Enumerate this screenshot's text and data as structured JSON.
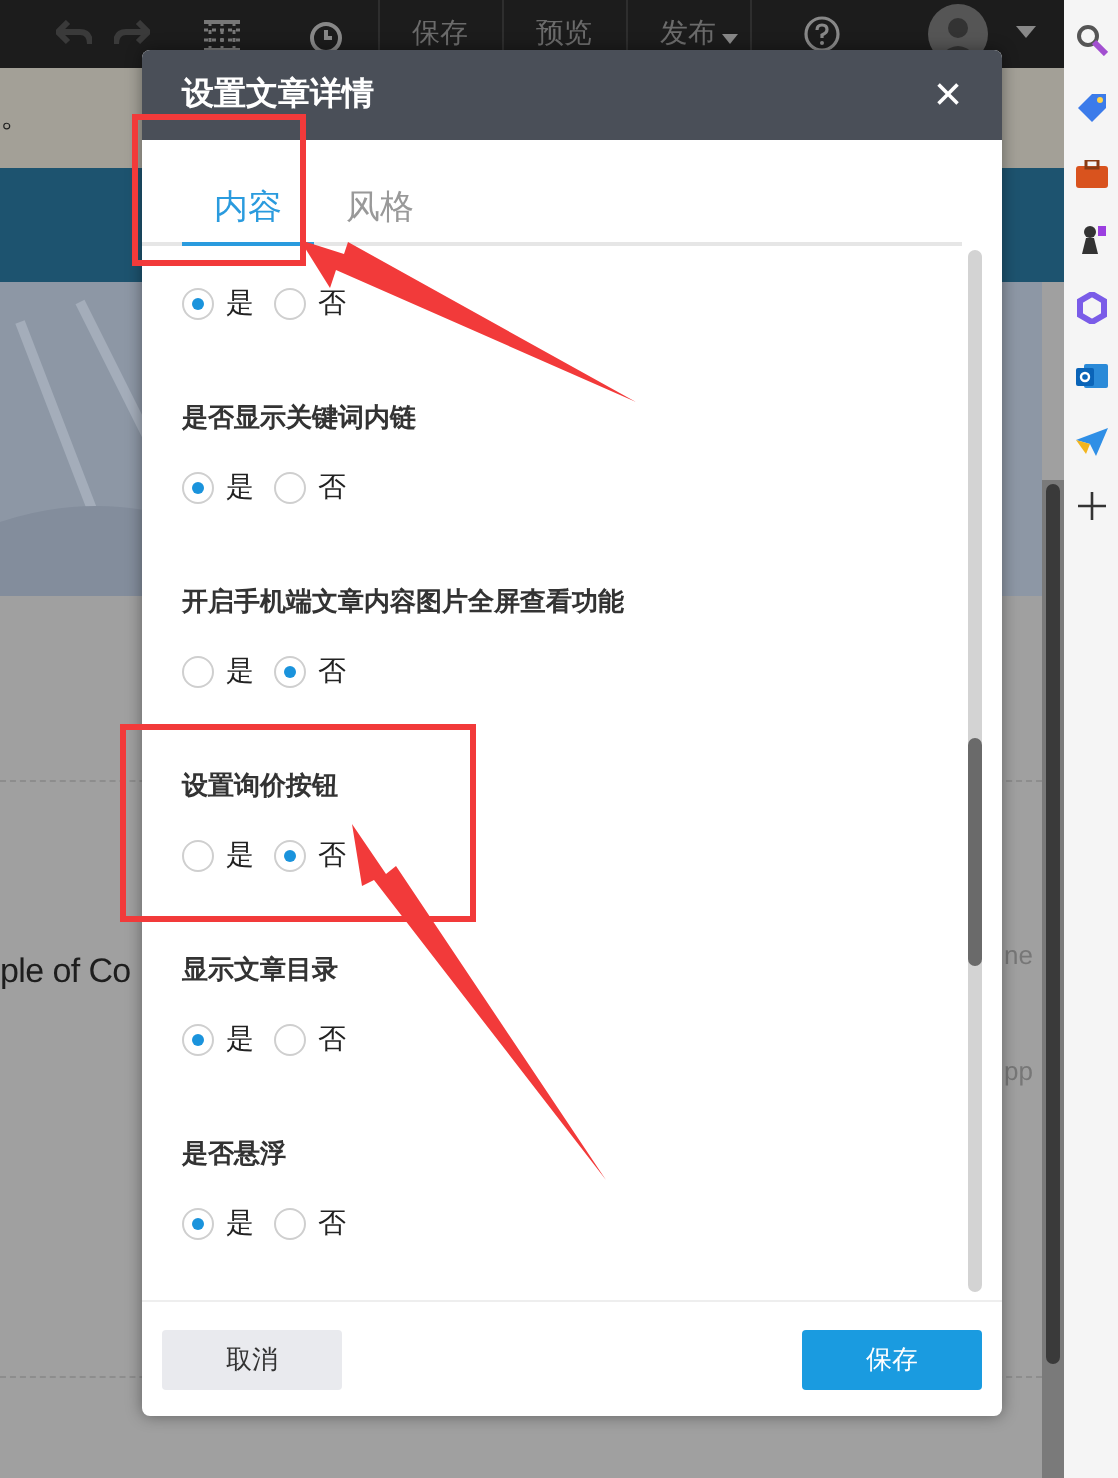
{
  "toolbar": {
    "items": [
      "保存",
      "预览",
      "发布"
    ]
  },
  "background": {
    "texts": [
      "。",
      "ple of Co",
      "ne",
      "pp"
    ]
  },
  "dialog": {
    "title": "设置文章详情",
    "close": "×",
    "tabs": [
      {
        "label": "内容",
        "selected": true
      },
      {
        "label": "风格",
        "selected": false
      }
    ],
    "options": [
      {
        "choices": [
          {
            "label": "是",
            "selected": true
          },
          {
            "label": "否",
            "selected": false
          }
        ]
      },
      {
        "label": "是否显示关键词内链",
        "choices": [
          {
            "label": "是",
            "selected": true
          },
          {
            "label": "否",
            "selected": false
          }
        ]
      },
      {
        "label": "开启手机端文章内容图片全屏查看功能",
        "choices": [
          {
            "label": "是",
            "selected": false
          },
          {
            "label": "否",
            "selected": true
          }
        ]
      },
      {
        "label": "设置询价按钮",
        "choices": [
          {
            "label": "是",
            "selected": false
          },
          {
            "label": "否",
            "selected": true
          }
        ]
      },
      {
        "label": "显示文章目录",
        "choices": [
          {
            "label": "是",
            "selected": true
          },
          {
            "label": "否",
            "selected": false
          }
        ]
      },
      {
        "label": "是否悬浮",
        "choices": [
          {
            "label": "是",
            "selected": true
          },
          {
            "label": "否",
            "selected": false
          }
        ]
      }
    ],
    "buttons": [
      {
        "kind": "cancel",
        "label": "取消"
      },
      {
        "kind": "primary",
        "label": "保存"
      }
    ]
  }
}
